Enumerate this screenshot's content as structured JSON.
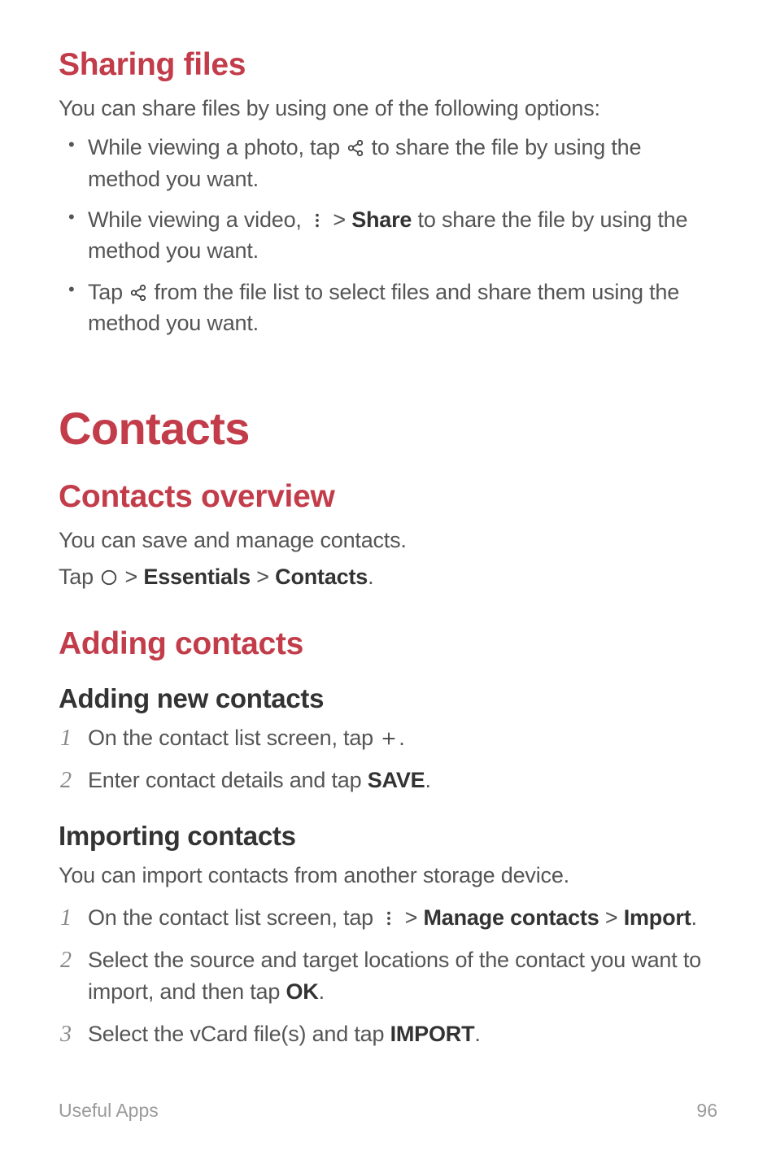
{
  "sharing_files": {
    "heading": "Sharing files",
    "intro": "You can share files by using one of the following options:",
    "bullets": [
      {
        "before": "While viewing a photo, tap ",
        "icon": "share",
        "after": " to share the file by using the method you want."
      },
      {
        "before": "While viewing a video, ",
        "icon": "more",
        "bold_after_icon": "Share",
        "after": " to share the file by using the method you want.",
        "sep": " > "
      },
      {
        "before": "Tap ",
        "icon": "share",
        "after": " from the file list to select files and share them using the method you want."
      }
    ]
  },
  "contacts": {
    "heading": "Contacts",
    "overview": {
      "heading": "Contacts overview",
      "text": "You can save and manage contacts.",
      "tap_pre": "Tap ",
      "tap_seq": [
        "Essentials",
        "Contacts"
      ]
    },
    "adding": {
      "heading": "Adding contacts",
      "new": {
        "heading": "Adding new contacts",
        "steps": [
          {
            "before": "On the contact list screen, tap ",
            "icon": "plus",
            "after": "."
          },
          {
            "before": "Enter contact details and tap ",
            "bold": "SAVE",
            "after": "."
          }
        ]
      },
      "importing": {
        "heading": "Importing contacts",
        "intro": "You can import contacts from another storage device.",
        "steps": [
          {
            "before": "On the contact list screen, tap ",
            "icon": "more",
            "seq": [
              "Manage contacts",
              "Import"
            ],
            "end": "."
          },
          {
            "before": "Select the source and target locations of the contact you want to import, and then tap ",
            "bold": "OK",
            "after": "."
          },
          {
            "before": "Select the vCard file(s) and tap ",
            "bold": "IMPORT",
            "after": "."
          }
        ]
      }
    }
  },
  "footer": {
    "left": "Useful Apps",
    "right": "96"
  }
}
